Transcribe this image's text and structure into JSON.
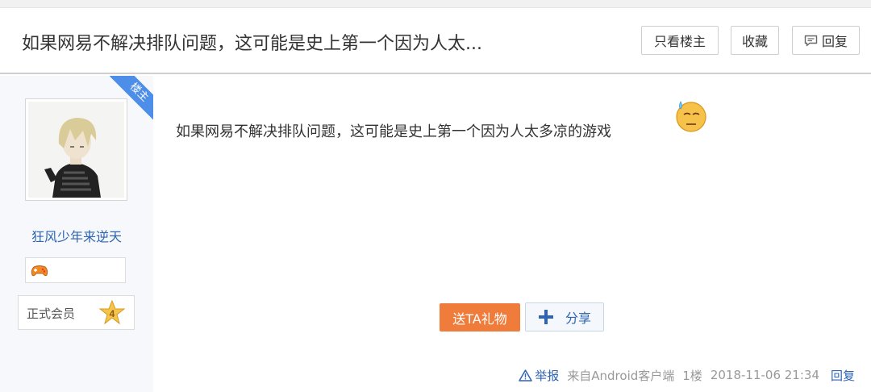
{
  "thread": {
    "title": "如果网易不解决排队问题，这可能是史上第一个因为人太...",
    "buttons": {
      "only_author": "只看楼主",
      "favorite": "收藏",
      "reply": "回复"
    }
  },
  "author": {
    "badge": "楼主",
    "username": "狂风少年来逆天",
    "member_label": "正式会员",
    "level": "4"
  },
  "post": {
    "content": "如果网易不解决排队问题，这可能是史上第一个因为人太多凉的游戏",
    "gift_label": "送TA礼物",
    "share_label": "分享"
  },
  "footer": {
    "report": "举报",
    "source": "来自Android客户端",
    "floor": "1楼",
    "timestamp": "2018-11-06 21:34",
    "reply": "回复"
  },
  "icons": {
    "reply": "speech-bubble-icon",
    "emoji": "sweat-face-icon",
    "share": "plus-cross-icon",
    "report": "warning-triangle-icon",
    "game": "gamepad-icon",
    "level": "star-badge-icon"
  },
  "colors": {
    "link_blue": "#2d64b3",
    "gift_orange": "#f07c3c",
    "badge_blue": "#4c8ee8",
    "sidebar_bg": "#f6f8fb"
  }
}
